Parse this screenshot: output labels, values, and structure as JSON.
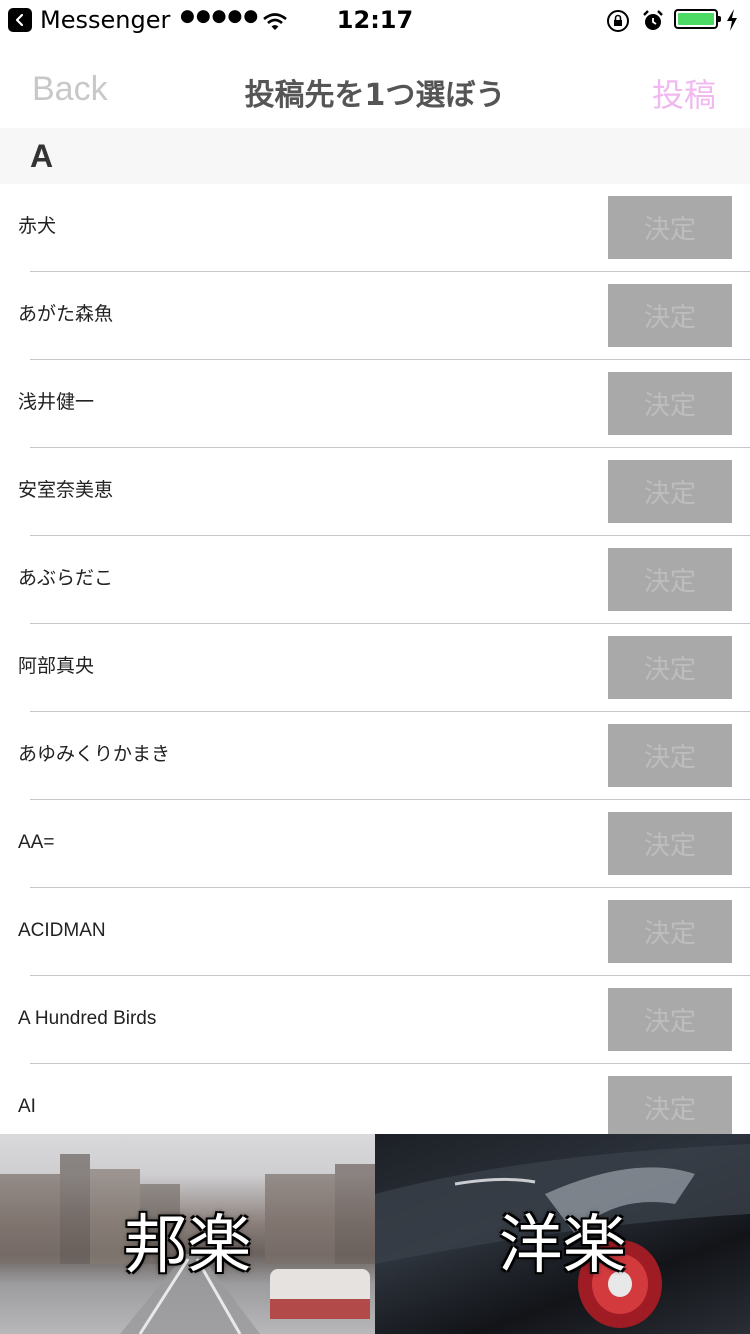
{
  "status_bar": {
    "app_name": "Messenger",
    "signal": "●●●●●",
    "time": "12:17",
    "battery_color": "#4cd964"
  },
  "nav": {
    "back_label": "Back",
    "title": "投稿先を1つ選ぼう",
    "post_label": "投稿"
  },
  "section": {
    "letter": "A"
  },
  "decide_label": "決定",
  "artists": [
    {
      "name": "赤犬"
    },
    {
      "name": "あがた森魚"
    },
    {
      "name": "浅井健一"
    },
    {
      "name": "安室奈美恵"
    },
    {
      "name": "あぶらだこ"
    },
    {
      "name": "阿部真央"
    },
    {
      "name": "あゆみくりかまき"
    },
    {
      "name": "AA="
    },
    {
      "name": "ACIDMAN"
    },
    {
      "name": "A Hundred Birds"
    },
    {
      "name": "AI"
    }
  ],
  "tabs": [
    {
      "label": "邦楽"
    },
    {
      "label": "洋楽"
    }
  ]
}
